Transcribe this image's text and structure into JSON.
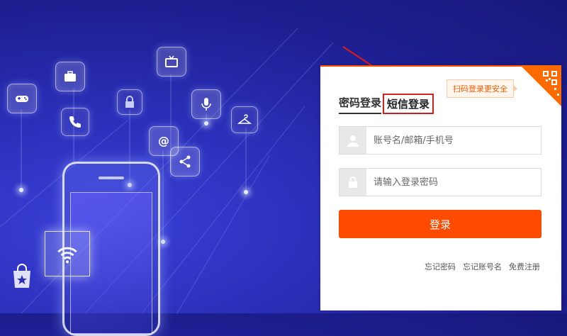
{
  "login": {
    "qr_tip": "扫码登录更安全",
    "tabs": [
      {
        "label": "密码登录"
      },
      {
        "label": "短信登录"
      }
    ],
    "username_placeholder": "账号名/邮箱/手机号",
    "password_placeholder": "请输入登录密码",
    "submit_label": "登录",
    "links": {
      "forgot_password": "忘记密码",
      "forgot_account": "忘记账号名",
      "register": "免费注册"
    }
  },
  "colors": {
    "accent": "#ff4b00",
    "highlight_box": "#d61f1f",
    "background": "#1d1e8f"
  },
  "icons": [
    "gamepad-icon",
    "briefcase-icon",
    "tv-icon",
    "lock-icon",
    "microphone-icon",
    "hanger-icon",
    "phone-icon",
    "at-icon",
    "share-icon",
    "wifi-icon",
    "shopping-bag-icon",
    "user-icon",
    "padlock-icon",
    "qr-code-icon"
  ]
}
